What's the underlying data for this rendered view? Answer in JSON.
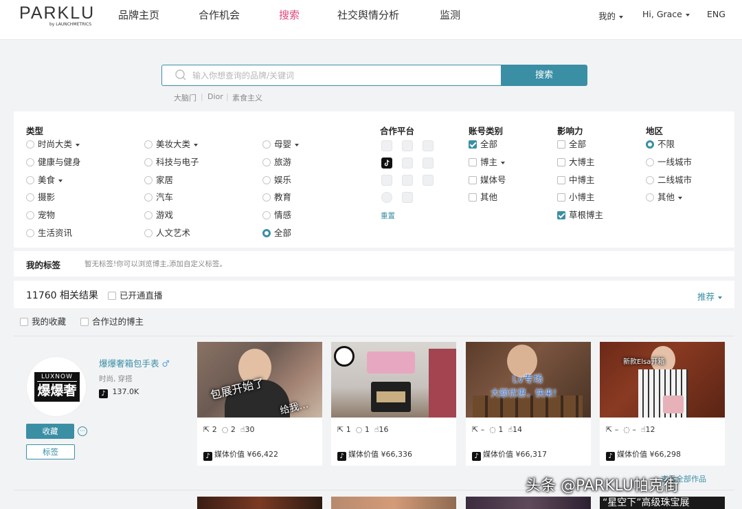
{
  "header": {
    "logo": "PARKLU",
    "logo_sub": "by LAUNCHMETRICS",
    "nav": [
      "品牌主页",
      "合作机会",
      "搜索",
      "社交舆情分析",
      "监测"
    ],
    "active_nav": "搜索",
    "right": {
      "my": "我的",
      "user": "Hi, Grace",
      "lang": "ENG"
    }
  },
  "search": {
    "placeholder": "输入你想查询的品牌/关键词",
    "button": "搜索",
    "hints": [
      "大脑门",
      "Dior",
      "素食主义"
    ]
  },
  "filters": {
    "type": {
      "title": "类型",
      "col1": [
        "时尚大类",
        "健康与健身",
        "美食",
        "摄影",
        "宠物",
        "生活资讯"
      ],
      "col2": [
        "美妆大类",
        "科技与电子",
        "家居",
        "汽车",
        "游戏",
        "人文艺术"
      ],
      "col3": [
        "母婴",
        "旅游",
        "娱乐",
        "教育",
        "情感",
        "全部"
      ],
      "selected": "全部"
    },
    "platform": {
      "title": "合作平台",
      "selected": "tiktok",
      "reset": "重置"
    },
    "account": {
      "title": "账号类别",
      "options": [
        "全部",
        "博主",
        "媒体号",
        "其他"
      ],
      "checked": [
        "全部"
      ]
    },
    "influence": {
      "title": "影响力",
      "options": [
        "全部",
        "大博主",
        "中博主",
        "小博主",
        "草根博主"
      ],
      "checked": [
        "草根博主"
      ]
    },
    "region": {
      "title": "地区",
      "options": [
        "不限",
        "一线城市",
        "二线城市",
        "其他"
      ],
      "selected": "不限"
    }
  },
  "my_tags": {
    "label": "我的标签",
    "empty_text": "暂无标签!你可以浏览博主,添加自定义标签。"
  },
  "results": {
    "count": "11760",
    "count_label": "相关结果",
    "live_filter": "已开通直播",
    "sort": "推荐",
    "my_fav": "我的收藏",
    "worked_with": "合作过的博主"
  },
  "influencer": {
    "name": "爆爆奢箱包手表",
    "gender_icon": "♂",
    "tags": "时尚, 穿搭",
    "followers": "137.0K",
    "avatar_text_top": "LUXNOW",
    "avatar_text_main": "爆爆奢",
    "fav_button": "收藏",
    "more_button": "···",
    "tag_button": "标签"
  },
  "posts": [
    {
      "overlay": "包展开始了",
      "overlay2": "给我…",
      "share": "2",
      "comments": "2",
      "likes": "30",
      "value_label": "媒体价值",
      "value": "¥66,422"
    },
    {
      "overlay": "",
      "overlay2": "",
      "share": "1",
      "comments": "1",
      "likes": "16",
      "value_label": "媒体价值",
      "value": "¥66,336"
    },
    {
      "overlay": "Lv专场",
      "overlay2": "大额优惠，快来!",
      "share": "–",
      "comments": "1",
      "likes": "14",
      "value_label": "媒体价值",
      "value": "¥66,317"
    },
    {
      "overlay": "新款Elsa开箱",
      "overlay2": "",
      "share": "–",
      "comments": "–",
      "likes": "12",
      "value_label": "媒体价值",
      "value": "¥66,298"
    }
  ],
  "next_row": {
    "banner_text": "“星空下”高级珠宝展"
  },
  "watermark": "头条 @PARKLU帕克街",
  "watermark_link": "查看全部作品"
}
